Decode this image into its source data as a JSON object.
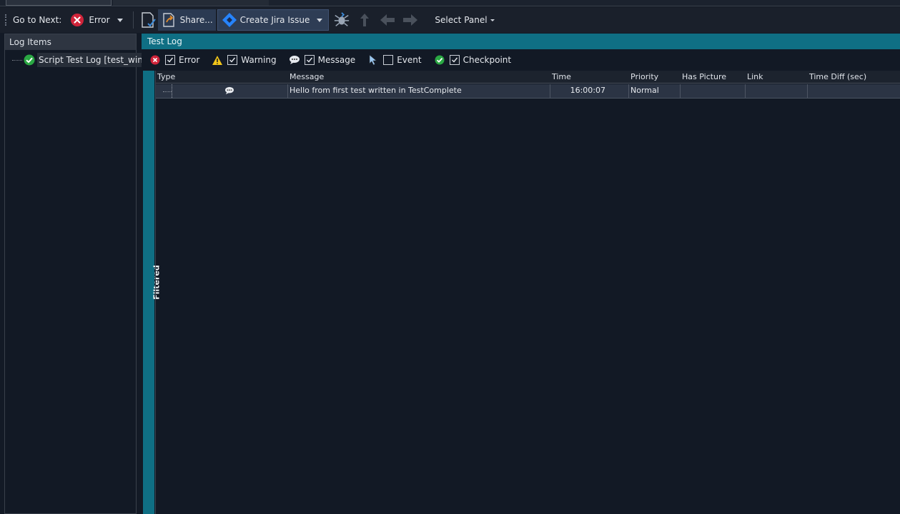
{
  "toolbar": {
    "goto_next_label": "Go to Next:",
    "error_label": "Error",
    "share_label": "Share...",
    "jira_label": "Create Jira Issue",
    "select_panel_label": "Select Panel"
  },
  "left_panel": {
    "title": "Log Items",
    "tree_item_label": "Script Test Log [test_win_..."
  },
  "right_panel": {
    "title": "Test Log",
    "filtered_label": "Filtered",
    "filters": {
      "error": "Error",
      "warning": "Warning",
      "message": "Message",
      "event": "Event",
      "checkpoint": "Checkpoint"
    },
    "columns": {
      "type": "Type",
      "message": "Message",
      "time": "Time",
      "priority": "Priority",
      "has_picture": "Has Picture",
      "link": "Link",
      "time_diff": "Time Diff (sec)"
    },
    "rows": [
      {
        "type_icon": "message-icon",
        "message": "Hello from first test written in TestComplete",
        "time": "16:00:07",
        "priority": "Normal",
        "has_picture": "",
        "link": "",
        "time_diff": ""
      }
    ]
  },
  "colors": {
    "accent_teal": "#0f6f84",
    "error_red": "#d0243a",
    "success_green": "#2aa843",
    "warning_yellow": "#f0c419",
    "background": "#131a26"
  }
}
